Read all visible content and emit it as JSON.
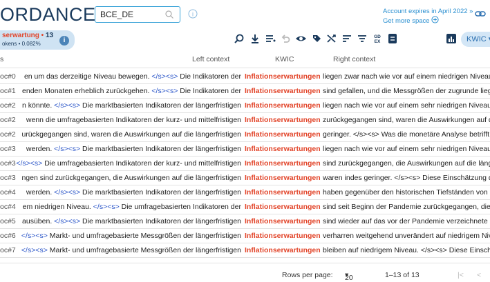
{
  "brand": "ORDANCE",
  "corpus": {
    "value": "BCE_DE"
  },
  "account": {
    "line1": "Account expires in April 2022 »",
    "line2": "Get more space"
  },
  "stats": {
    "query": "serwartung",
    "count": "13",
    "line2": "okens • 0.082%"
  },
  "view": {
    "label": "KWIC"
  },
  "table": {
    "headers": {
      "ref": "s",
      "left": "Left context",
      "kwic": "KWIC",
      "right": "Right context"
    },
    "rows": [
      {
        "ref": "oc#0",
        "left_text": "en um das derzeitige Niveau bewegen.",
        "left_tag": "</s><s>",
        "left_rest": "Die Indikatoren der",
        "kwic": "Inflationserwartungen",
        "right": "liegen zwar nach wie vor auf einem niedrigen Niveau"
      },
      {
        "ref": "oc#1",
        "left_text": "enden Monaten erheblich zurückgehen.",
        "left_tag": "</s><s>",
        "left_rest": "Die Indikatoren der",
        "kwic": "Inflationserwartungen",
        "right": "sind gefallen, und die Messgrößen der zugrunde liege"
      },
      {
        "ref": "oc#2",
        "left_text": "n könnte.",
        "left_tag": "</s><s>",
        "left_rest": "Die marktbasierten Indikatoren der längerfristigen",
        "kwic": "Inflationserwartungen",
        "right": "liegen nach wie vor auf einem sehr niedrigen Niveau."
      },
      {
        "ref": "oc#2",
        "left_text": "wenn die umfragebasierten Indikatoren der kurz- und mittelfristigen",
        "left_tag": "",
        "left_rest": "",
        "kwic": "Inflationserwartungen",
        "right": "zurückgegangen sind, waren die Auswirkungen auf d"
      },
      {
        "ref": "oc#2",
        "left_text": "urückgegangen sind, waren die Auswirkungen auf die längerfristigen",
        "left_tag": "",
        "left_rest": "",
        "kwic": "Inflationserwartungen",
        "right": "geringer. </s><s> Was die monetäre Analyse betrifft,"
      },
      {
        "ref": "oc#3",
        "left_text": "werden.",
        "left_tag": "</s><s>",
        "left_rest": "Die marktbasierten Indikatoren der längerfristigen",
        "kwic": "Inflationserwartungen",
        "right": "liegen nach wie vor auf einem sehr niedrigen Niveau."
      },
      {
        "ref": "oc#3",
        "left_text": "",
        "left_tag": "</s><s>",
        "left_rest": "Die umfragebasierten Indikatoren der kurz- und mittelfristigen",
        "kwic": "Inflationserwartungen",
        "right": "sind zurückgegangen, die Auswirkungen auf die länge"
      },
      {
        "ref": "oc#3",
        "left_text": "ngen sind zurückgegangen, die Auswirkungen auf die längerfristigen",
        "left_tag": "",
        "left_rest": "",
        "kwic": "Inflationserwartungen",
        "right": "waren indes geringer. </s><s> Diese Einschätzung de"
      },
      {
        "ref": "oc#4",
        "left_text": "werden.",
        "left_tag": "</s><s>",
        "left_rest": "Die marktbasierten Indikatoren der längerfristigen",
        "kwic": "Inflationserwartungen",
        "right": "haben gegenüber den historischen Tiefständen von M"
      },
      {
        "ref": "oc#4",
        "left_text": "em niedrigen Niveau.",
        "left_tag": "</s><s>",
        "left_rest": "Die umfragebasierten Indikatoren der",
        "kwic": "Inflationserwartungen",
        "right": "sind seit Beginn der Pandemie zurückgegangen, die"
      },
      {
        "ref": "oc#5",
        "left_text": "ausüben.",
        "left_tag": "</s><s>",
        "left_rest": "Die marktbasierten Indikatoren der längerfristigen",
        "kwic": "Inflationserwartungen",
        "right": "sind wieder auf das vor der Pandemie verzeichnete N"
      },
      {
        "ref": "oc#6",
        "left_text": "",
        "left_tag": "</s><s>",
        "left_rest": "Markt- und umfragebasierte Messgrößen der längerfristigen",
        "kwic": "Inflationserwartungen",
        "right": "verharren weitgehend unverändert auf niedrigem Niv"
      },
      {
        "ref": "oc#7",
        "left_text": "",
        "left_tag": "</s><s>",
        "left_rest": "Markt- und umfragebasierte Messgrößen der längerfristigen",
        "kwic": "Inflationserwartungen",
        "right": "bleiben auf niedrigem Niveau. </s><s> Diese Einschä"
      }
    ]
  },
  "footer": {
    "rows_label": "Rows per page:",
    "rows_value": "20",
    "range": "1–13 of 13"
  }
}
